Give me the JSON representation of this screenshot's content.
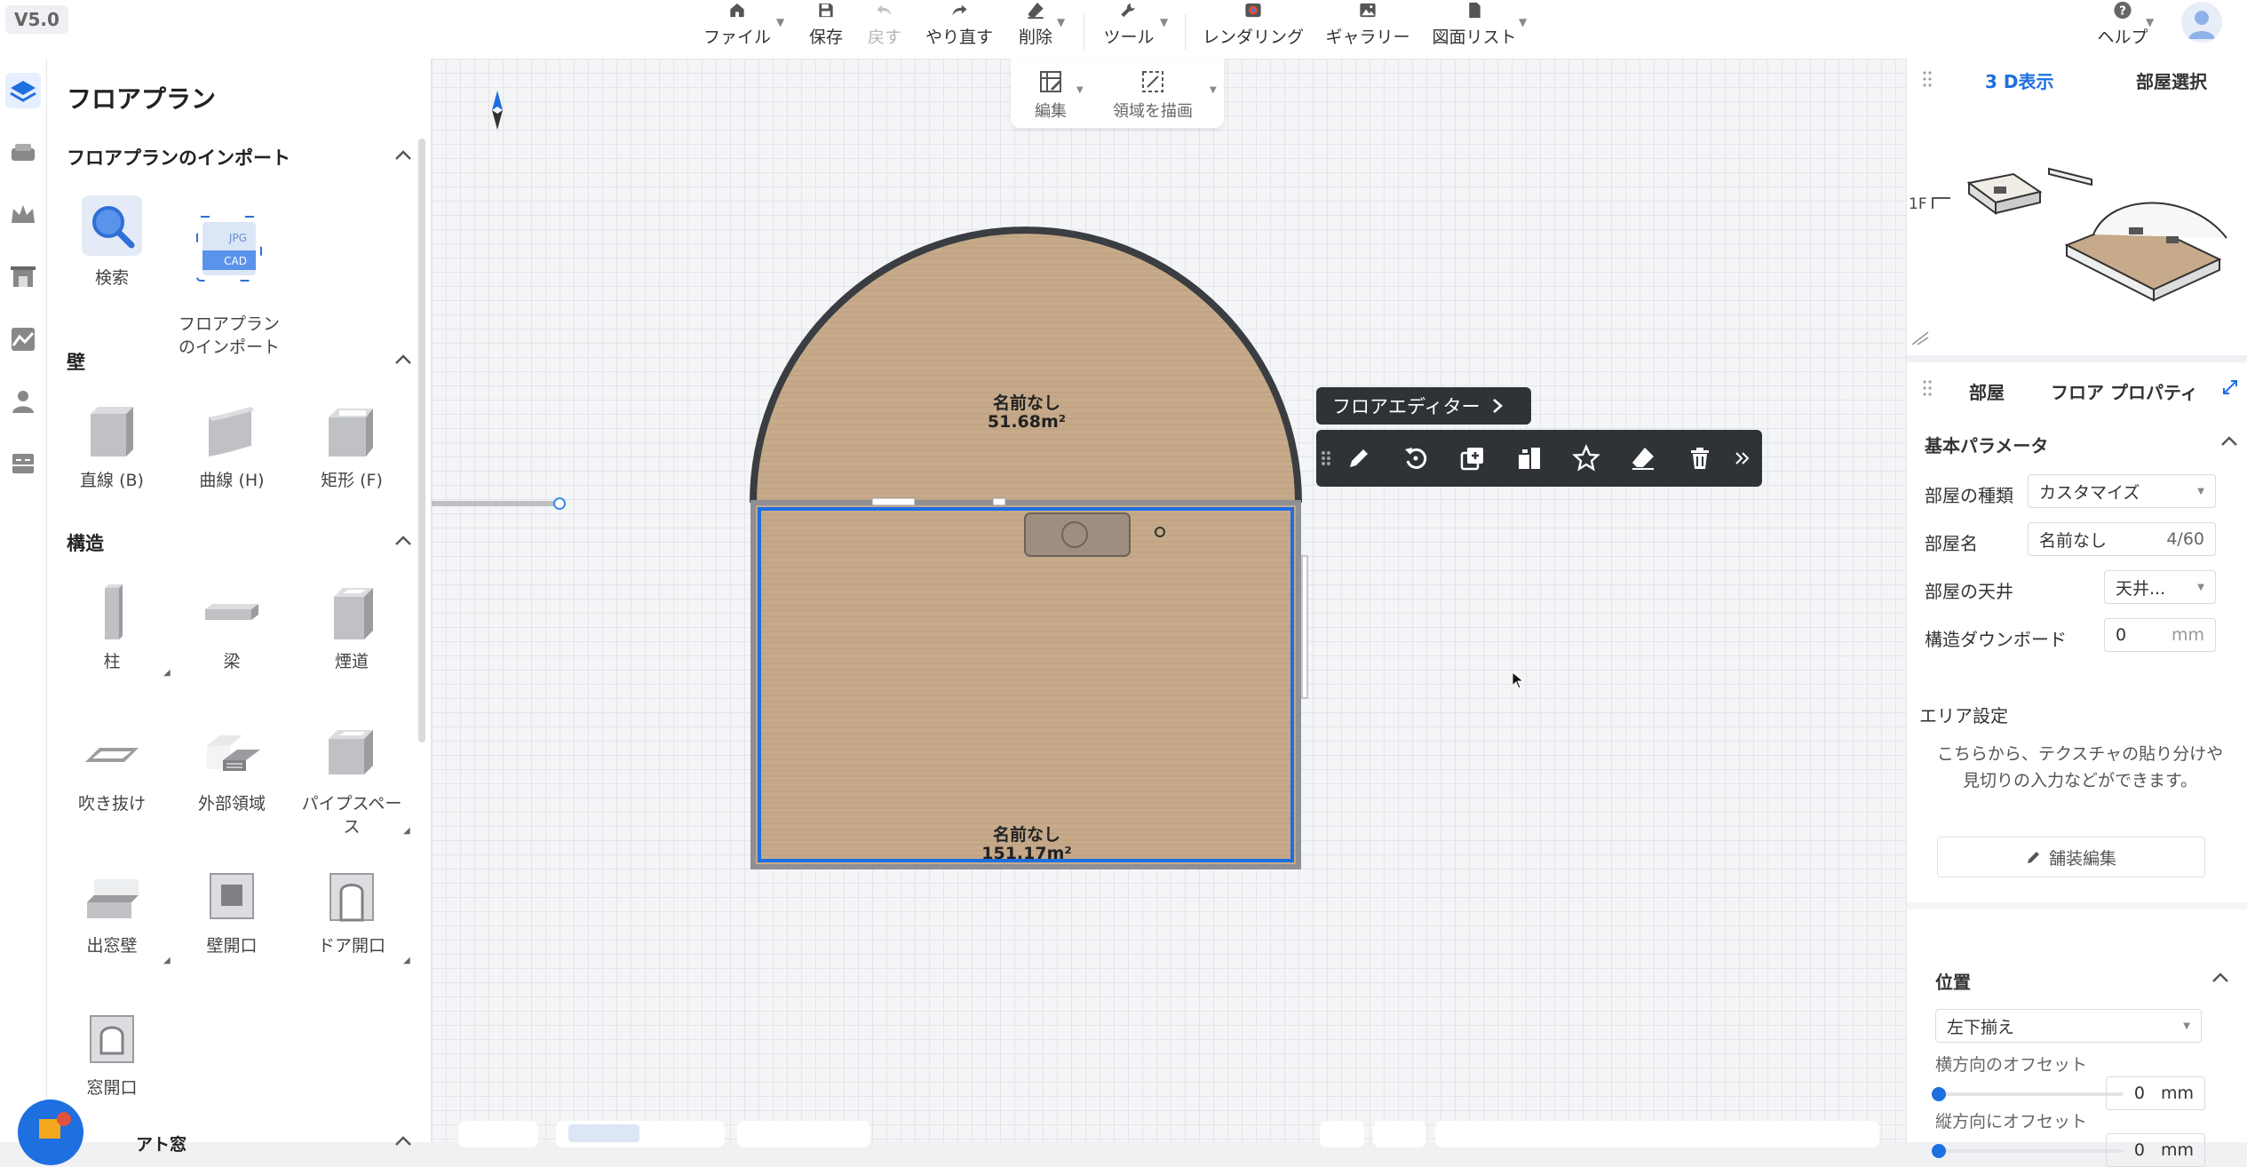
{
  "app": {
    "version": "V5.0"
  },
  "toolbar": {
    "file": "ファイル",
    "save": "保存",
    "undo": "戻す",
    "redo": "やり直す",
    "delete": "削除",
    "tools": "ツール",
    "rendering": "レンダリング",
    "gallery": "ギャラリー",
    "drawing_list": "図面リスト",
    "help": "ヘルプ"
  },
  "draw_toolbar": {
    "edit": "編集",
    "draw_area": "領域を描画"
  },
  "left_panel": {
    "title": "フロアプラン",
    "import_section": {
      "title": "フロアプランのインポート",
      "items": [
        {
          "label": "検索",
          "icon": "search-icon"
        },
        {
          "label": "フロアプラン\nのインポート",
          "icon": "cad-import-icon",
          "badge_top": "JPG",
          "badge_bottom": "CAD"
        }
      ]
    },
    "wall_section": {
      "title": "壁",
      "items": [
        {
          "label": "直線 (B)",
          "icon": "straight-wall-icon"
        },
        {
          "label": "曲線 (H)",
          "icon": "curved-wall-icon"
        },
        {
          "label": "矩形 (F)",
          "icon": "rect-wall-icon"
        }
      ]
    },
    "structure_section": {
      "title": "構造",
      "items": [
        {
          "label": "柱",
          "icon": "column-icon"
        },
        {
          "label": "梁",
          "icon": "beam-icon"
        },
        {
          "label": "煙道",
          "icon": "flue-icon"
        },
        {
          "label": "吹き抜け",
          "icon": "void-icon"
        },
        {
          "label": "外部領域",
          "icon": "outer-area-icon"
        },
        {
          "label": "パイプスペース",
          "icon": "pipe-space-icon"
        },
        {
          "label": "出窓壁",
          "icon": "bay-window-wall-icon"
        },
        {
          "label": "壁開口",
          "icon": "wall-opening-icon"
        },
        {
          "label": "ドア開口",
          "icon": "door-opening-icon"
        },
        {
          "label": "窓開口",
          "icon": "window-opening-icon"
        }
      ]
    },
    "next_section_partial": "アト窓"
  },
  "canvas": {
    "rooms": [
      {
        "name": "名前なし",
        "area": "51.68m²"
      },
      {
        "name": "名前なし",
        "area": "151.17m²"
      }
    ]
  },
  "floor_editor": {
    "label": "フロアエディター"
  },
  "right_panel": {
    "tabs": {
      "view3d": "3 D表示",
      "room_select": "部屋選択"
    },
    "floor_label": "1F",
    "prop_tabs": {
      "room": "部屋",
      "floor_props": "フロア プロパティ"
    },
    "basic_params": {
      "title": "基本パラメータ",
      "room_type_label": "部屋の種類",
      "room_type_value": "カスタマイズ",
      "room_name_label": "部屋名",
      "room_name_value": "名前なし",
      "room_name_count": "4/60",
      "ceiling_label": "部屋の天井",
      "ceiling_value": "天井...",
      "downboard_label": "構造ダウンボード",
      "downboard_value": "0",
      "downboard_unit": "mm"
    },
    "area_settings": {
      "title": "エリア設定",
      "desc": "こちらから、テクスチャの貼り分けや 見切りの入力などができます。",
      "button": "舗装編集"
    },
    "position": {
      "title": "位置",
      "align_value": "左下揃え",
      "h_offset_label": "横方向のオフセット",
      "h_offset_value": "0",
      "v_offset_label": "縦方向にオフセット",
      "v_offset_value": "0",
      "unit": "mm"
    }
  },
  "colors": {
    "accent": "#1e6fe0",
    "floor_wood": "#c4a888",
    "dark_toolbar": "#2f3338"
  }
}
